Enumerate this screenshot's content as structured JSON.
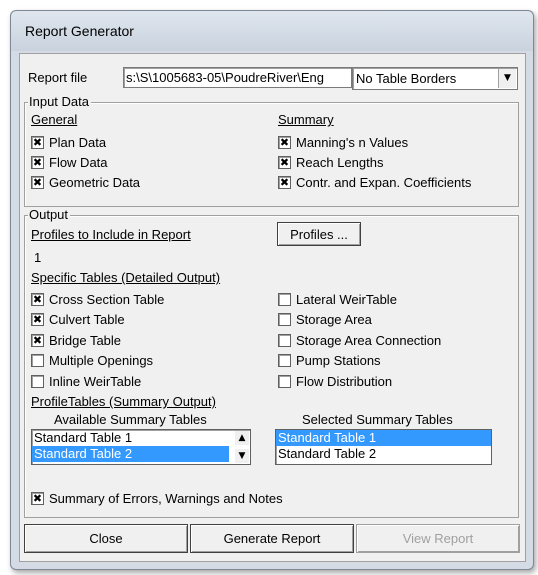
{
  "window": {
    "title": "Report Generator"
  },
  "report_file": {
    "label": "Report file",
    "value": "s:\\S\\1005683-05\\PoudreRiver\\Eng",
    "border_option": "No Table Borders"
  },
  "input_data": {
    "legend": "Input Data",
    "general": {
      "heading": "General",
      "items": [
        {
          "label": "Plan Data",
          "checked": true
        },
        {
          "label": "Flow Data",
          "checked": true
        },
        {
          "label": "Geometric Data",
          "checked": true
        }
      ]
    },
    "summary": {
      "heading": "Summary",
      "items": [
        {
          "label": "Manning's n Values",
          "checked": true
        },
        {
          "label": "Reach Lengths",
          "checked": true
        },
        {
          "label": "Contr. and Expan. Coefficients",
          "checked": true
        }
      ]
    }
  },
  "output": {
    "legend": "Output",
    "profiles_heading": "Profiles to Include in Report",
    "profiles_button": "Profiles ...",
    "profiles_value": "1",
    "specific_heading": "Specific Tables (Detailed Output)",
    "specific_left": [
      {
        "label": "Cross Section Table",
        "checked": true
      },
      {
        "label": "Culvert Table",
        "checked": true
      },
      {
        "label": "Bridge Table",
        "checked": true
      },
      {
        "label": "Multiple Openings",
        "checked": false
      },
      {
        "label": "Inline WeirTable",
        "checked": false
      }
    ],
    "specific_right": [
      {
        "label": "Lateral WeirTable",
        "checked": false
      },
      {
        "label": "Storage Area",
        "checked": false
      },
      {
        "label": "Storage Area Connection",
        "checked": false
      },
      {
        "label": "Pump Stations",
        "checked": false
      },
      {
        "label": "Flow Distribution",
        "checked": false
      }
    ],
    "profile_tables_heading": "ProfileTables (Summary Output)",
    "available": {
      "heading": "Available Summary Tables",
      "items": [
        "Standard Table 1",
        "Standard Table 2"
      ],
      "selected_index": 1
    },
    "selected": {
      "heading": "Selected Summary Tables",
      "items": [
        "Standard Table 1",
        "Standard Table 2"
      ],
      "selected_index": 0
    }
  },
  "summary_errors": {
    "label": "Summary of Errors, Warnings and Notes",
    "checked": true
  },
  "buttons": {
    "close": "Close",
    "generate": "Generate Report",
    "view": "View Report"
  },
  "colors": {
    "selection": "#3399ff",
    "face": "#f0f0f0",
    "disabled_text": "#a0a0a0"
  },
  "glyphs": {
    "check": "✖",
    "arrow_down": "▼",
    "arrow_up": "▲"
  }
}
